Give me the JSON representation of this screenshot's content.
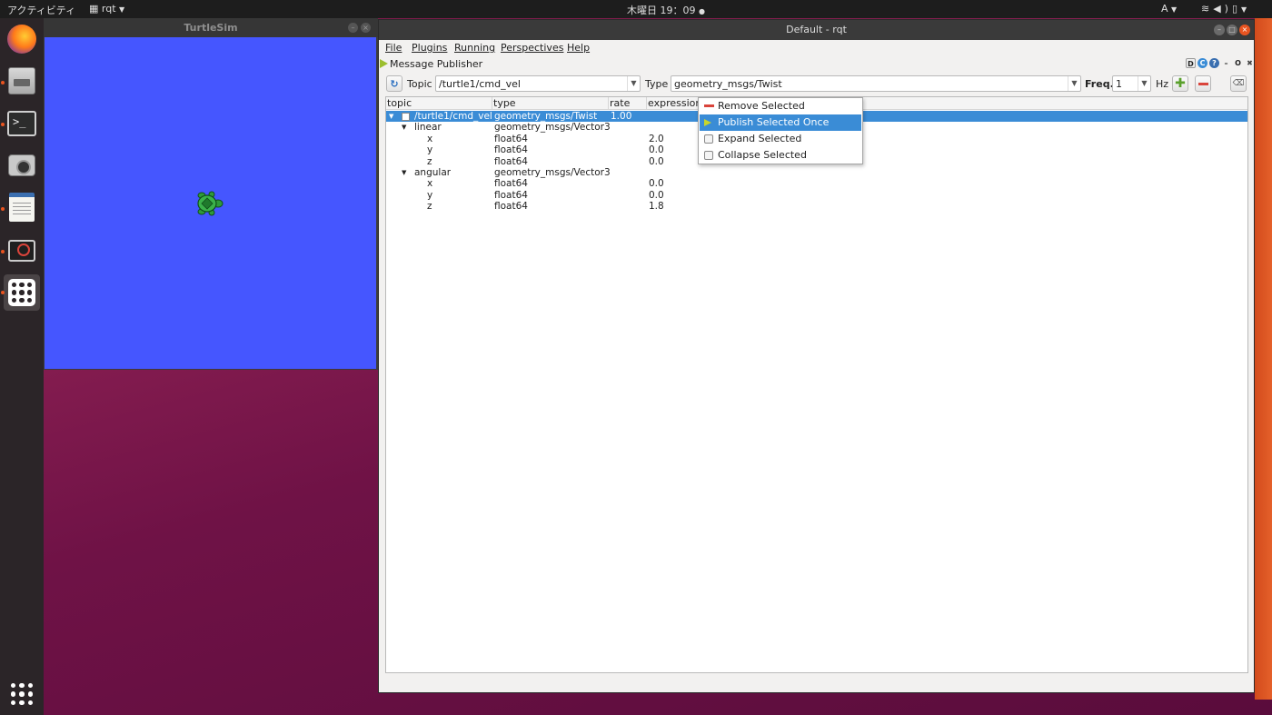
{
  "topbar": {
    "activities": "アクティビティ",
    "app_menu": "rqt",
    "clock": "木曜日 19：09",
    "lang": "A",
    "tray": "⇡ ◀) ⊕"
  },
  "dock": {
    "items": [
      "firefox-icon",
      "files-icon",
      "terminal-icon",
      "camera-icon",
      "text-editor-icon",
      "rqt-icon",
      "turtlesim-icon"
    ]
  },
  "turtlesim": {
    "title": "TurtleSim",
    "background": "#4556ff"
  },
  "rqt": {
    "title": "Default - rqt",
    "menus": [
      "File",
      "Plugins",
      "Running",
      "Perspectives",
      "Help"
    ],
    "plugin_title": "Message Publisher",
    "plugin_controls": "D",
    "toolbar": {
      "topic_label": "Topic",
      "topic_value": "/turtle1/cmd_vel",
      "type_label": "Type",
      "type_value": "geometry_msgs/Twist",
      "freq_label": "Freq.",
      "freq_value": "1",
      "hz_label": "Hz"
    },
    "columns": [
      "topic",
      "type",
      "rate",
      "expression"
    ],
    "rows": [
      {
        "topic": "/turtle1/cmd_vel",
        "type": "geometry_msgs/Twist",
        "rate": "1.00",
        "expression": ""
      },
      {
        "topic": "linear",
        "type": "geometry_msgs/Vector3",
        "rate": "",
        "expression": ""
      },
      {
        "topic": "x",
        "type": "float64",
        "rate": "",
        "expression": "2.0"
      },
      {
        "topic": "y",
        "type": "float64",
        "rate": "",
        "expression": "0.0"
      },
      {
        "topic": "z",
        "type": "float64",
        "rate": "",
        "expression": "0.0"
      },
      {
        "topic": "angular",
        "type": "geometry_msgs/Vector3",
        "rate": "",
        "expression": ""
      },
      {
        "topic": "x",
        "type": "float64",
        "rate": "",
        "expression": "0.0"
      },
      {
        "topic": "y",
        "type": "float64",
        "rate": "",
        "expression": "0.0"
      },
      {
        "topic": "z",
        "type": "float64",
        "rate": "",
        "expression": "1.8"
      }
    ],
    "context_menu": [
      "Remove Selected",
      "Publish Selected Once",
      "Expand Selected",
      "Collapse Selected"
    ]
  },
  "colors": {
    "selection": "#3a8cd6",
    "accent": "#e95420"
  }
}
